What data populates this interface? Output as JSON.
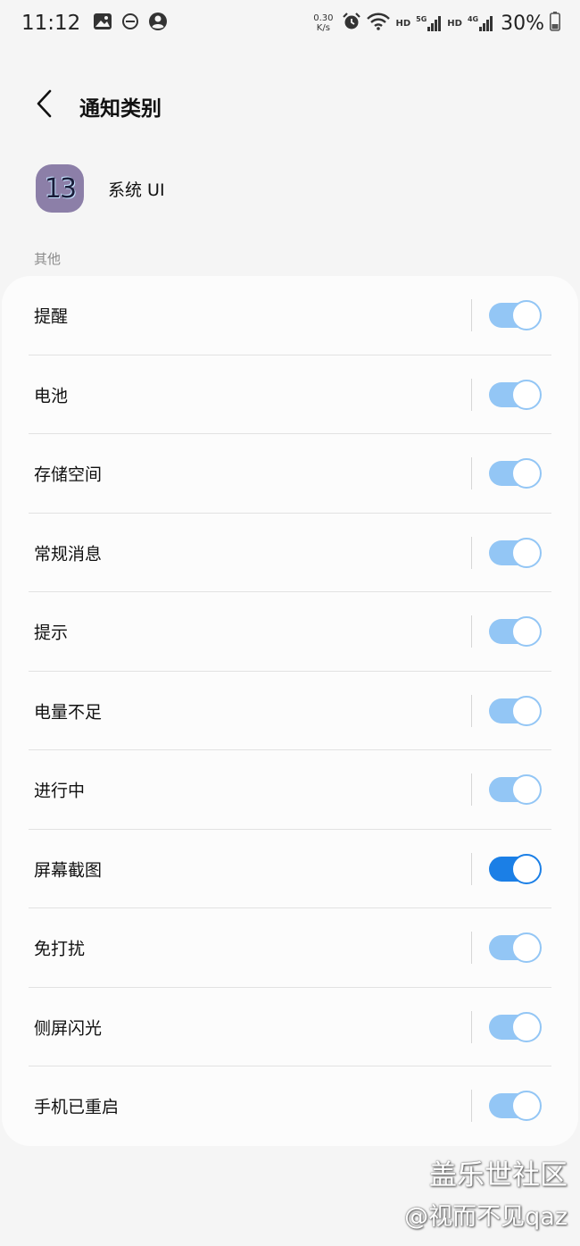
{
  "status_bar": {
    "time": "11:12",
    "net_speed_value": "0.30",
    "net_speed_unit": "K/s",
    "hd1": "HD",
    "sig1_label": "5G",
    "hd2": "HD",
    "sig2_label": "4G",
    "battery": "30%"
  },
  "header": {
    "title": "通知类别"
  },
  "app": {
    "icon_text": "13",
    "name": "系统 UI"
  },
  "section": {
    "label": "其他"
  },
  "colors": {
    "toggle_on_light": "#93c6f5",
    "toggle_on_strong": "#1b7fe6"
  },
  "items": [
    {
      "label": "提醒",
      "on": true
    },
    {
      "label": "电池",
      "on": true
    },
    {
      "label": "存储空间",
      "on": true
    },
    {
      "label": "常规消息",
      "on": true
    },
    {
      "label": "提示",
      "on": true
    },
    {
      "label": "电量不足",
      "on": true
    },
    {
      "label": "进行中",
      "on": true
    },
    {
      "label": "屏幕截图",
      "on": true
    },
    {
      "label": "免打扰",
      "on": true
    },
    {
      "label": "侧屏闪光",
      "on": true
    },
    {
      "label": "手机已重启",
      "on": true
    }
  ],
  "watermark": {
    "line1": "盖乐世社区",
    "line2": "@视而不见qaz"
  }
}
